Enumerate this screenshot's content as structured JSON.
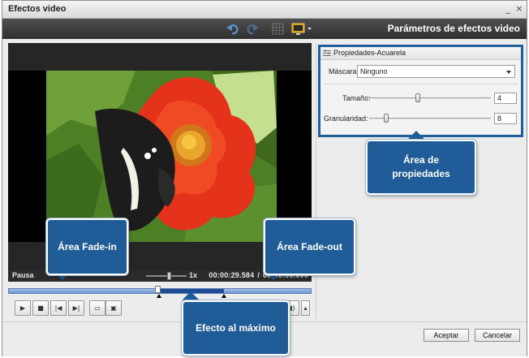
{
  "window": {
    "title": "Efectos video",
    "minimize_glyph": "_",
    "close_glyph": "×"
  },
  "toolbar": {
    "title": "Parámetros de efectos video",
    "icons": [
      "undo-icon",
      "redo-icon",
      "grid-icon",
      "monitor-icon"
    ]
  },
  "player": {
    "status": "Pausa",
    "speed": "1x",
    "current_time": "00:00:29.584",
    "time_separator": "/",
    "total_time": "00:00:00.000",
    "speed_level": 0.52,
    "playhead_fraction": 0.49,
    "controls": [
      "play-icon",
      "stop-icon",
      "skip-back-icon",
      "skip-forward-icon",
      "fit-icon",
      "fullscreen-icon",
      "volume-icon"
    ]
  },
  "properties": {
    "title": "Propiedades-Acuarela",
    "mask_label": "Máscara",
    "mask_value": "Ninguno",
    "size_label": "Tamaño:",
    "size_value": "4",
    "size_level": 0.4,
    "granularity_label": "Granularidad:",
    "granularity_value": "8",
    "granularity_level": 0.14
  },
  "buttons": {
    "accept": "Aceptar",
    "cancel": "Cancelar"
  },
  "callouts": {
    "properties_area_line1": "Área de",
    "properties_area_line2": "propiedades",
    "fade_in": "Área Fade-in",
    "fade_out": "Área Fade-out",
    "effect_max": "Efecto al máximo"
  },
  "colors": {
    "callout": "#1f5c98",
    "toolbar": "#3a3a3a",
    "timeline": "#8fb0e0",
    "timeline_effect": "#1e4c94",
    "properties_border": "#1f5f9b"
  }
}
